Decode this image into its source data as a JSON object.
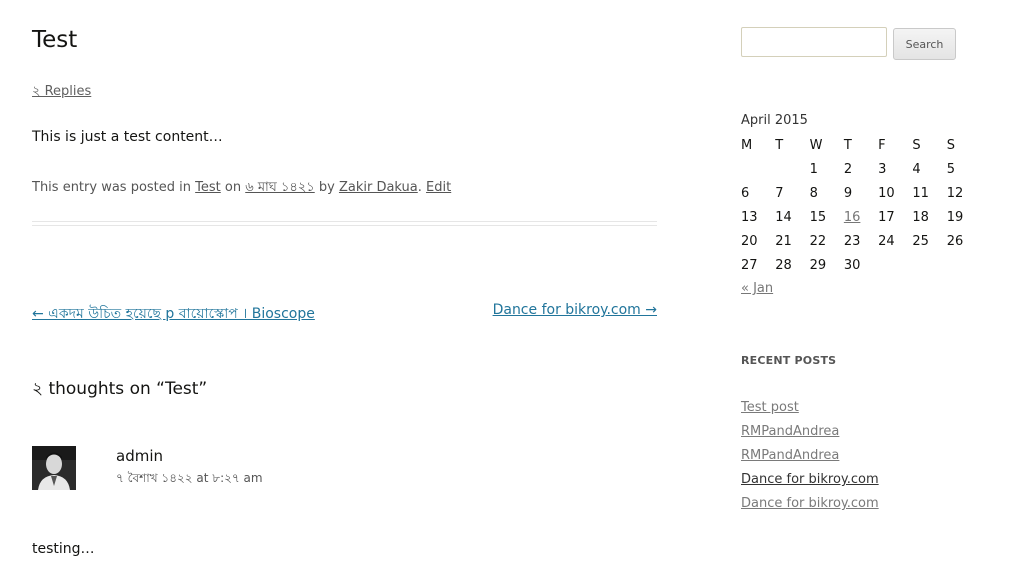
{
  "post": {
    "title": "Test",
    "replies_link": "২ Replies",
    "content": "This is just a test content…",
    "meta": {
      "prefix": "This entry was posted in ",
      "category": "Test",
      "on": " on ",
      "date": "৬ মাঘ ১৪২১",
      "by": " by ",
      "author": "Zakir Dakua",
      "dot": ". ",
      "edit": "Edit"
    }
  },
  "post_nav": {
    "previous": "← একদম উচিত হয়েছে p বায়োস্কোপ । Bioscope",
    "next": "Dance for bikroy.com →"
  },
  "comments": {
    "title": "২ thoughts on “Test”",
    "items": [
      {
        "author": "admin",
        "date": "৭ বৈশাখ ১৪২২ at ৮:২৭ am",
        "text": "testing…"
      }
    ]
  },
  "sidebar": {
    "search": {
      "button_label": "Search",
      "placeholder": ""
    },
    "calendar": {
      "caption": "April 2015",
      "weekdays": [
        "M",
        "T",
        "W",
        "T",
        "F",
        "S",
        "S"
      ],
      "weeks": [
        [
          "",
          "",
          "1",
          "2",
          "3",
          "4",
          "5"
        ],
        [
          "6",
          "7",
          "8",
          "9",
          "10",
          "11",
          "12"
        ],
        [
          "13",
          "14",
          "15",
          "16",
          "17",
          "18",
          "19"
        ],
        [
          "20",
          "21",
          "22",
          "23",
          "24",
          "25",
          "26"
        ],
        [
          "27",
          "28",
          "29",
          "30",
          "",
          "",
          ""
        ]
      ],
      "linked_days": [
        "16"
      ],
      "prev_link": "« Jan"
    },
    "recent_posts": {
      "title": "RECENT POSTS",
      "items": [
        "Test post",
        "RMPandAndrea",
        "RMPandAndrea",
        "Dance for bikroy.com",
        "Dance for bikroy.com"
      ]
    }
  },
  "colors": {
    "link": "#21759b",
    "text": "#141412",
    "muted": "#777777"
  }
}
